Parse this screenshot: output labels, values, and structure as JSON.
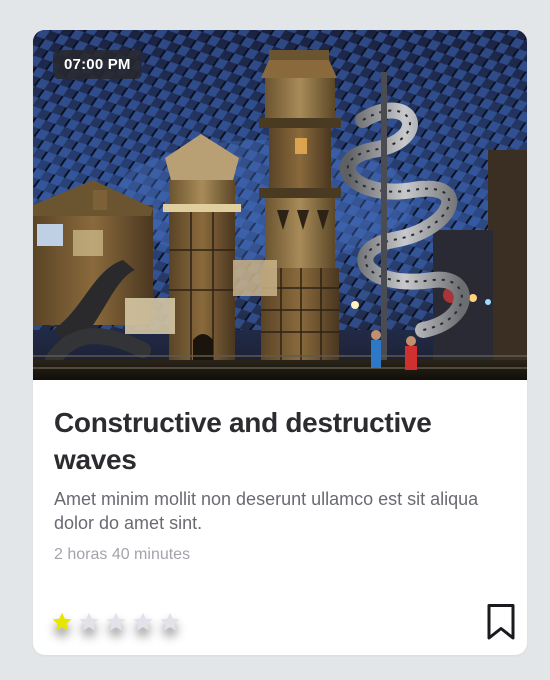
{
  "card": {
    "image_label": "Indoor theme park with wooden towers and spiral slides",
    "time": "07:00 PM",
    "title": "Constructive and destructive waves",
    "description": "Amet minim mollit non deserunt ullamco est sit aliqua dolor do amet sint.",
    "duration": "2 horas 40 minutes",
    "rating": {
      "value": 1,
      "max": 5
    },
    "bookmark_icon": "bookmark-icon"
  },
  "colors": {
    "background": "#e3e6e8",
    "card": "#ffffff",
    "title": "#2b2b30",
    "description": "#6a6a72",
    "duration": "#a3a3ab",
    "star_filled": "#e6e600",
    "star_empty": "#e2e2ea",
    "bookmark": "#1a1a1e"
  }
}
